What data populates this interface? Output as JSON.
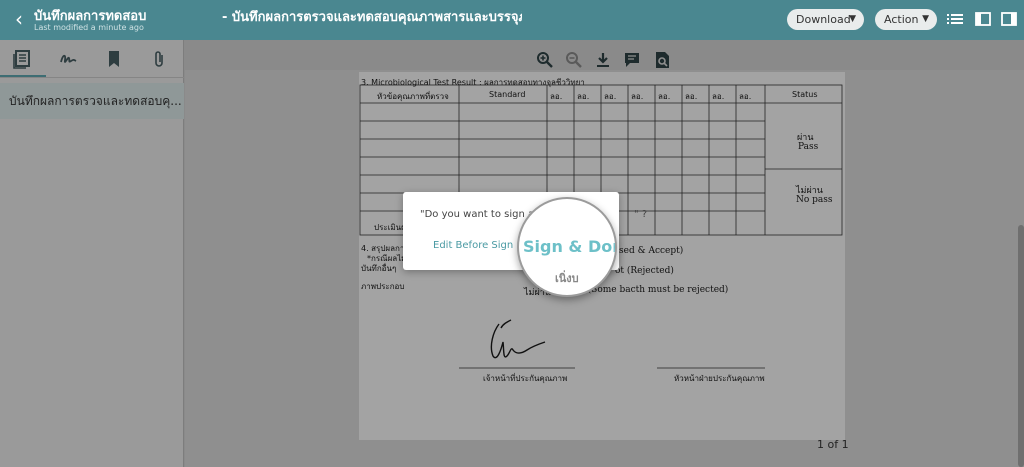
{
  "header": {
    "back_icon": "chevron-left-icon",
    "doc_title": "บันทึกผลการทดสอบ",
    "modified": "Last modified a minute ago",
    "center_title": "- บันทึกผลการตรวจและทดสอบคุณภาพสารและบรรจุภัณ...",
    "download_label": "Download",
    "action_label": "Action"
  },
  "sidebar": {
    "tabs": [
      "document-list-icon",
      "signature-icon",
      "bookmark-icon",
      "paperclip-icon"
    ],
    "item_label": "บันทึกผลการตรวจและทดสอบคุ..."
  },
  "toolbar": [
    "zoom-in-icon",
    "zoom-out-icon",
    "download-icon",
    "comment-icon",
    "search-doc-icon"
  ],
  "document": {
    "section3_title": "3. Microbiological Test Result : ผลการทดสอบทางจุลชีววิทยา",
    "col_item": "หัวข้อคุณภาพที่ตรวจ",
    "col_standard": "Standard",
    "col_lot": "ลอ.",
    "col_status": "Status",
    "pass_th": "ผ่าน",
    "pass_en": "Pass",
    "nopass_th": "ไม่ผ่าน",
    "nopass_en": "No pass",
    "eval_label": "ประเมินผ",
    "section4_title": "4. สรุปผลการ",
    "note1": "*กรณีผลไม่",
    "note2": "บันทึกอื่นๆ",
    "note3": "ภาพประกอบ",
    "accept_text": "sed & Accept)",
    "reject_text": "ot (Rejected)",
    "partial_prefix": "ไม่ผ่าน",
    "partial_text": "n (Some bacth must be rejected)",
    "sig1_label": "เจ้าหน้าที่ประกันคุณภาพ",
    "sig2_label": "หัวหน้าฝ่ายประกันคุณภาพ"
  },
  "pagination": {
    "text": "1 of 1"
  },
  "modal": {
    "question": "\"Do you want to sign all",
    "question_end": "\" ?",
    "edit_label": "Edit Before Sign",
    "done_label": "Sign & Done",
    "under_label": "เนิ่งบ"
  },
  "colors": {
    "header": "#4a8790",
    "accent": "#6dc0c8",
    "link": "#4a9aa3"
  }
}
